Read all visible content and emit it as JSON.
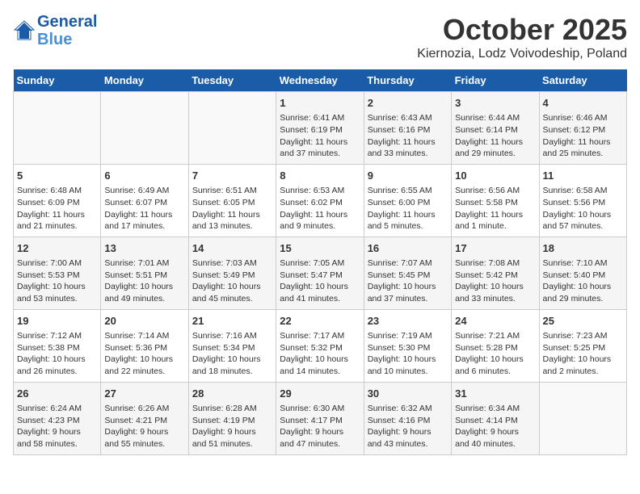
{
  "header": {
    "logo_line1": "General",
    "logo_line2": "Blue",
    "month": "October 2025",
    "location": "Kiernozia, Lodz Voivodeship, Poland"
  },
  "weekdays": [
    "Sunday",
    "Monday",
    "Tuesday",
    "Wednesday",
    "Thursday",
    "Friday",
    "Saturday"
  ],
  "rows": [
    [
      {
        "day": "",
        "info": ""
      },
      {
        "day": "",
        "info": ""
      },
      {
        "day": "",
        "info": ""
      },
      {
        "day": "1",
        "info": "Sunrise: 6:41 AM\nSunset: 6:19 PM\nDaylight: 11 hours\nand 37 minutes."
      },
      {
        "day": "2",
        "info": "Sunrise: 6:43 AM\nSunset: 6:16 PM\nDaylight: 11 hours\nand 33 minutes."
      },
      {
        "day": "3",
        "info": "Sunrise: 6:44 AM\nSunset: 6:14 PM\nDaylight: 11 hours\nand 29 minutes."
      },
      {
        "day": "4",
        "info": "Sunrise: 6:46 AM\nSunset: 6:12 PM\nDaylight: 11 hours\nand 25 minutes."
      }
    ],
    [
      {
        "day": "5",
        "info": "Sunrise: 6:48 AM\nSunset: 6:09 PM\nDaylight: 11 hours\nand 21 minutes."
      },
      {
        "day": "6",
        "info": "Sunrise: 6:49 AM\nSunset: 6:07 PM\nDaylight: 11 hours\nand 17 minutes."
      },
      {
        "day": "7",
        "info": "Sunrise: 6:51 AM\nSunset: 6:05 PM\nDaylight: 11 hours\nand 13 minutes."
      },
      {
        "day": "8",
        "info": "Sunrise: 6:53 AM\nSunset: 6:02 PM\nDaylight: 11 hours\nand 9 minutes."
      },
      {
        "day": "9",
        "info": "Sunrise: 6:55 AM\nSunset: 6:00 PM\nDaylight: 11 hours\nand 5 minutes."
      },
      {
        "day": "10",
        "info": "Sunrise: 6:56 AM\nSunset: 5:58 PM\nDaylight: 11 hours\nand 1 minute."
      },
      {
        "day": "11",
        "info": "Sunrise: 6:58 AM\nSunset: 5:56 PM\nDaylight: 10 hours\nand 57 minutes."
      }
    ],
    [
      {
        "day": "12",
        "info": "Sunrise: 7:00 AM\nSunset: 5:53 PM\nDaylight: 10 hours\nand 53 minutes."
      },
      {
        "day": "13",
        "info": "Sunrise: 7:01 AM\nSunset: 5:51 PM\nDaylight: 10 hours\nand 49 minutes."
      },
      {
        "day": "14",
        "info": "Sunrise: 7:03 AM\nSunset: 5:49 PM\nDaylight: 10 hours\nand 45 minutes."
      },
      {
        "day": "15",
        "info": "Sunrise: 7:05 AM\nSunset: 5:47 PM\nDaylight: 10 hours\nand 41 minutes."
      },
      {
        "day": "16",
        "info": "Sunrise: 7:07 AM\nSunset: 5:45 PM\nDaylight: 10 hours\nand 37 minutes."
      },
      {
        "day": "17",
        "info": "Sunrise: 7:08 AM\nSunset: 5:42 PM\nDaylight: 10 hours\nand 33 minutes."
      },
      {
        "day": "18",
        "info": "Sunrise: 7:10 AM\nSunset: 5:40 PM\nDaylight: 10 hours\nand 29 minutes."
      }
    ],
    [
      {
        "day": "19",
        "info": "Sunrise: 7:12 AM\nSunset: 5:38 PM\nDaylight: 10 hours\nand 26 minutes."
      },
      {
        "day": "20",
        "info": "Sunrise: 7:14 AM\nSunset: 5:36 PM\nDaylight: 10 hours\nand 22 minutes."
      },
      {
        "day": "21",
        "info": "Sunrise: 7:16 AM\nSunset: 5:34 PM\nDaylight: 10 hours\nand 18 minutes."
      },
      {
        "day": "22",
        "info": "Sunrise: 7:17 AM\nSunset: 5:32 PM\nDaylight: 10 hours\nand 14 minutes."
      },
      {
        "day": "23",
        "info": "Sunrise: 7:19 AM\nSunset: 5:30 PM\nDaylight: 10 hours\nand 10 minutes."
      },
      {
        "day": "24",
        "info": "Sunrise: 7:21 AM\nSunset: 5:28 PM\nDaylight: 10 hours\nand 6 minutes."
      },
      {
        "day": "25",
        "info": "Sunrise: 7:23 AM\nSunset: 5:25 PM\nDaylight: 10 hours\nand 2 minutes."
      }
    ],
    [
      {
        "day": "26",
        "info": "Sunrise: 6:24 AM\nSunset: 4:23 PM\nDaylight: 9 hours\nand 58 minutes."
      },
      {
        "day": "27",
        "info": "Sunrise: 6:26 AM\nSunset: 4:21 PM\nDaylight: 9 hours\nand 55 minutes."
      },
      {
        "day": "28",
        "info": "Sunrise: 6:28 AM\nSunset: 4:19 PM\nDaylight: 9 hours\nand 51 minutes."
      },
      {
        "day": "29",
        "info": "Sunrise: 6:30 AM\nSunset: 4:17 PM\nDaylight: 9 hours\nand 47 minutes."
      },
      {
        "day": "30",
        "info": "Sunrise: 6:32 AM\nSunset: 4:16 PM\nDaylight: 9 hours\nand 43 minutes."
      },
      {
        "day": "31",
        "info": "Sunrise: 6:34 AM\nSunset: 4:14 PM\nDaylight: 9 hours\nand 40 minutes."
      },
      {
        "day": "",
        "info": ""
      }
    ]
  ]
}
